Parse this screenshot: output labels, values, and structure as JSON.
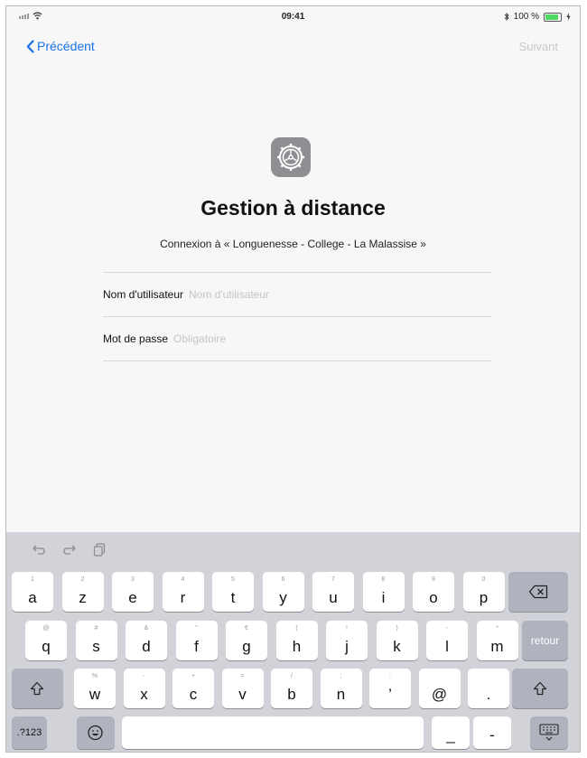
{
  "status_bar": {
    "time": "09:41",
    "battery": "100 %",
    "battery_level": 1.0
  },
  "nav": {
    "back_label": "Précédent",
    "next_label": "Suivant"
  },
  "main": {
    "icon": "settings-gear-icon",
    "title": "Gestion à distance",
    "subtitle": "Connexion à « Longuenesse - College - La Malassise »"
  },
  "form": {
    "username": {
      "label": "Nom d'utilisateur",
      "placeholder": "Nom d'utilisateur",
      "value": ""
    },
    "password": {
      "label": "Mot de passe",
      "placeholder": "Obligatoire",
      "value": ""
    }
  },
  "keyboard": {
    "toolbar": [
      "undo-icon",
      "redo-icon",
      "paste-icon"
    ],
    "row1": [
      {
        "hint": "1",
        "char": "a"
      },
      {
        "hint": "2",
        "char": "z"
      },
      {
        "hint": "3",
        "char": "e"
      },
      {
        "hint": "4",
        "char": "r"
      },
      {
        "hint": "5",
        "char": "t"
      },
      {
        "hint": "6",
        "char": "y"
      },
      {
        "hint": "7",
        "char": "u"
      },
      {
        "hint": "8",
        "char": "i"
      },
      {
        "hint": "9",
        "char": "o"
      },
      {
        "hint": "0",
        "char": "p"
      }
    ],
    "row2": [
      {
        "hint": "@",
        "char": "q"
      },
      {
        "hint": "#",
        "char": "s"
      },
      {
        "hint": "&",
        "char": "d"
      },
      {
        "hint": "\"",
        "char": "f"
      },
      {
        "hint": "€",
        "char": "g"
      },
      {
        "hint": "(",
        "char": "h"
      },
      {
        "hint": "!",
        "char": "j"
      },
      {
        "hint": ")",
        "char": "k"
      },
      {
        "hint": "-",
        "char": "l"
      },
      {
        "hint": "*",
        "char": "m"
      }
    ],
    "row3": [
      {
        "hint": "%",
        "char": "w"
      },
      {
        "hint": "-",
        "char": "x"
      },
      {
        "hint": "+",
        "char": "c"
      },
      {
        "hint": "=",
        "char": "v"
      },
      {
        "hint": "/",
        "char": "b"
      },
      {
        "hint": ";",
        "char": "n"
      },
      {
        "hint": ":",
        "char": "’"
      },
      {
        "hint": "",
        "char": "@"
      },
      {
        "hint": "",
        "char": "."
      }
    ],
    "return_label": "retour",
    "numbers_label": ".?123",
    "underscore_label": "_",
    "dash_label": "-"
  }
}
